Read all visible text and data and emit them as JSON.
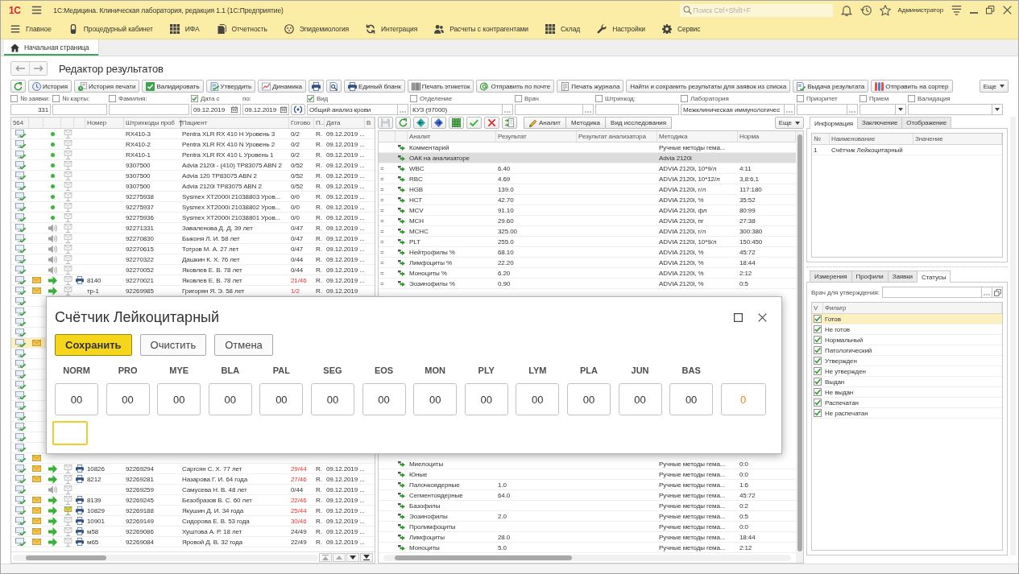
{
  "window": {
    "logo": "1С",
    "title": "1С:Медицина. Клиническая лаборатория, редакция 1.1 (1С:Предприятие)",
    "search": {
      "placeholder": "Поиск Ctrl+Shift+F"
    },
    "user": "Администратор"
  },
  "sections": [
    {
      "label": "Главное"
    },
    {
      "label": "Процедурный кабинет"
    },
    {
      "label": "ИФА"
    },
    {
      "label": "Отчетность"
    },
    {
      "label": "Эпидемиология"
    },
    {
      "label": "Интеграция"
    },
    {
      "label": "Расчеты с контрагентами"
    },
    {
      "label": "Склад"
    },
    {
      "label": "Настройки"
    },
    {
      "label": "Сервис"
    }
  ],
  "page_tabs": [
    {
      "label": "Начальная страница",
      "selected": true
    }
  ],
  "form": {
    "title": "Редактор результатов"
  },
  "toolbar": {
    "buttons": [
      {
        "label": "История"
      },
      {
        "label": "История печати"
      },
      {
        "label": "Валидировать"
      },
      {
        "label": "Утвердить"
      },
      {
        "label": "Динамика"
      },
      {
        "label": "Единый бланк"
      },
      {
        "label": "Печать этикеток"
      },
      {
        "label": "Отправить по почте"
      },
      {
        "label": "Печать журнала"
      },
      {
        "label": "Найти и сохранить результаты для заявок из списка"
      },
      {
        "label": "Выдача результата"
      },
      {
        "label": "Отправить на сортер"
      }
    ],
    "more": "Еще"
  },
  "filters": [
    {
      "label": "№ заявки:",
      "checked": false,
      "kind": "number",
      "value": "331"
    },
    {
      "label": "№ карты:",
      "checked": false,
      "kind": "text"
    },
    {
      "label": "Фамилия:",
      "checked": false,
      "kind": "text"
    },
    {
      "label": "Дата с",
      "checked": true,
      "kind": "date",
      "value": "09.12.2019"
    },
    {
      "label": "по:",
      "kind": "date",
      "value": "09.12.2019"
    },
    {
      "label": "Вид",
      "checked": true,
      "kind": "choice",
      "value": "Общий анализ крови"
    },
    {
      "label": "Отделение",
      "checked": false,
      "kind": "choice",
      "value": "КУЗ (97000)"
    },
    {
      "label": "Врач",
      "checked": false,
      "kind": "choice"
    },
    {
      "label": "Штрихкод:",
      "checked": false,
      "kind": "text"
    },
    {
      "label": "Лаборатория",
      "checked": false,
      "kind": "choice",
      "value": "Межклиническая иммунологичес"
    },
    {
      "label": "Приоритет",
      "checked": false,
      "kind": "choice"
    },
    {
      "label": "Прием",
      "checked": false,
      "kind": "select"
    },
    {
      "label": "Валидация",
      "checked": false,
      "kind": "select"
    }
  ],
  "samples": {
    "count": "564",
    "columns": [
      {
        "label": "Номер",
        "sorted": false
      },
      {
        "label": "Штрихкоды проб",
        "sorted": true
      },
      {
        "label": "Пациент",
        "sorted": false
      },
      {
        "label": "Готово",
        "sorted": false
      },
      {
        "label": "П..",
        "sorted": false
      },
      {
        "label": "Дата",
        "sorted": false
      },
      {
        "label": "В",
        "sorted": false
      }
    ],
    "rows_top": [
      {
        "selected": false,
        "sent": false,
        "kind": "control",
        "tray_active": false,
        "printed": false,
        "barcode": "RX410-3",
        "patient": "Pentra XLR RX 410 H Уровень 3",
        "ready": "0/2",
        "ready_alert": false,
        "p": "R.",
        "date": "09.12.2019 ..."
      },
      {
        "selected": false,
        "sent": false,
        "kind": "control",
        "tray_active": false,
        "printed": false,
        "barcode": "RX410-2",
        "patient": "Pentra XLR RX 410 N Уровень 2",
        "ready": "0/2",
        "ready_alert": false,
        "p": "R.",
        "date": "09.12.2019 ..."
      },
      {
        "selected": false,
        "sent": false,
        "kind": "control",
        "tray_active": false,
        "printed": false,
        "barcode": "RX410-1",
        "patient": "Pentra XLR RX 410 L Уровень 1",
        "ready": "0/2",
        "ready_alert": false,
        "p": "R.",
        "date": "09.12.2019 ..."
      },
      {
        "selected": false,
        "sent": false,
        "kind": "control",
        "tray_active": false,
        "printed": false,
        "barcode": "9307500",
        "patient": "Advia 2120i - (410) TP83075 ABN 2",
        "ready": "0/52",
        "ready_alert": false,
        "p": "R.",
        "date": "09.12.2019 ..."
      },
      {
        "selected": false,
        "sent": false,
        "kind": "control",
        "tray_active": false,
        "printed": false,
        "barcode": "9307500",
        "patient": "Advia 120 TP83075 ABN 2",
        "ready": "0/52",
        "ready_alert": false,
        "p": "R.",
        "date": "09.12.2019 ..."
      },
      {
        "selected": false,
        "sent": false,
        "kind": "control",
        "tray_active": false,
        "printed": false,
        "barcode": "9307500",
        "patient": "Advia 2120i TP83075 ABN 2",
        "ready": "0/52",
        "ready_alert": false,
        "p": "R.",
        "date": "09.12.2019 ..."
      },
      {
        "selected": false,
        "sent": false,
        "kind": "control",
        "tray_active": false,
        "printed": false,
        "barcode": "92275938",
        "patient": "Sysmex XT2000i 21038803 Уров...",
        "ready": "0/0",
        "ready_alert": false,
        "p": "R.",
        "date": "09.12.2019 ..."
      },
      {
        "selected": false,
        "sent": false,
        "kind": "control",
        "tray_active": false,
        "printed": false,
        "barcode": "92275937",
        "patient": "Sysmex XT2000i 21038802 Уров...",
        "ready": "0/0",
        "ready_alert": false,
        "p": "R.",
        "date": "09.12.2019 ..."
      },
      {
        "selected": false,
        "sent": false,
        "kind": "control",
        "tray_active": false,
        "printed": false,
        "barcode": "92275936",
        "patient": "Sysmex XT2000i 21038801 Уров...",
        "ready": "0/0",
        "ready_alert": false,
        "p": "R.",
        "date": "09.12.2019 ..."
      },
      {
        "selected": false,
        "sent": false,
        "kind": "waiting",
        "tray_active": false,
        "printed": false,
        "barcode": "92271331",
        "patient": "Заваленова Д. Д. 39 лет",
        "ready": "0/47",
        "ready_alert": false,
        "p": "R.",
        "date": "09.12.2019 ..."
      },
      {
        "selected": false,
        "sent": false,
        "kind": "waiting",
        "tray_active": false,
        "printed": false,
        "barcode": "92270830",
        "patient": "Быконя Л. И. 58 лет",
        "ready": "0/47",
        "ready_alert": false,
        "p": "R.",
        "date": "09.12.2019 ..."
      },
      {
        "selected": false,
        "sent": false,
        "kind": "waiting",
        "tray_active": false,
        "printed": false,
        "barcode": "92270615",
        "patient": "Тотров М. А. 27 лет",
        "ready": "0/47",
        "ready_alert": false,
        "p": "R.",
        "date": "09.12.2019 ..."
      },
      {
        "selected": false,
        "sent": false,
        "kind": "waiting",
        "tray_active": false,
        "printed": false,
        "barcode": "92270322",
        "patient": "Дашкин К. Х. 76 лет",
        "ready": "0/44",
        "ready_alert": false,
        "p": "R.",
        "date": "09.12.2019 ..."
      },
      {
        "selected": false,
        "sent": false,
        "kind": "waiting",
        "tray_active": false,
        "printed": false,
        "barcode": "92270052",
        "patient": "Яковлев Е. В. 78 лет",
        "ready": "0/44",
        "ready_alert": false,
        "p": "R.",
        "date": "09.12.2019 ..."
      },
      {
        "selected": false,
        "sent": true,
        "kind": "sent",
        "tray_active": false,
        "printed": true,
        "number": "8140",
        "barcode": "92270021",
        "patient": "Яковлев Е. В. 78 лет",
        "ready": "21/46",
        "ready_alert": true,
        "p": "R.",
        "date": "09.12.2019 ..."
      },
      {
        "selected": false,
        "sent": true,
        "kind": "sent",
        "tray_active": false,
        "printed": false,
        "number": "тр-1",
        "barcode": "92269985",
        "patient": "Григорян Я. Э. 58 лет",
        "ready": "1/2",
        "ready_alert": true,
        "p": "R.",
        "date": "09.12.2019"
      }
    ],
    "rows_covered": [
      {
        "selected": false,
        "sent": false
      },
      {
        "selected": false,
        "sent": false
      },
      {
        "selected": false,
        "sent": false
      },
      {
        "selected": false,
        "sent": false
      },
      {
        "selected": true,
        "sent": true
      },
      {
        "selected": false,
        "sent": false
      },
      {
        "selected": false,
        "sent": false
      },
      {
        "selected": false,
        "sent": false
      },
      {
        "selected": false,
        "sent": false
      },
      {
        "selected": false,
        "sent": false
      },
      {
        "selected": false,
        "sent": false
      },
      {
        "selected": false,
        "sent": false
      },
      {
        "selected": false,
        "sent": false
      },
      {
        "selected": false,
        "sent": false
      },
      {
        "selected": false,
        "sent": false
      },
      {
        "selected": false,
        "sent": true
      }
    ],
    "rows_bottom": [
      {
        "selected": false,
        "sent": true,
        "kind": "sent",
        "tray_active": false,
        "printed": true,
        "number": "10826",
        "barcode": "92269294",
        "patient": "Саргсян С. Х. 77 лет",
        "ready": "29/44",
        "ready_alert": true,
        "p": "R.",
        "date": "09.12.2019 ..."
      },
      {
        "selected": false,
        "sent": true,
        "kind": "sent",
        "tray_active": false,
        "printed": true,
        "number": "8212",
        "barcode": "92269281",
        "patient": "Назарова Г. И. 64 года",
        "ready": "27/46",
        "ready_alert": true,
        "p": "R.",
        "date": "09.12.2019 ..."
      },
      {
        "selected": false,
        "sent": false,
        "kind": "waiting",
        "tray_active": false,
        "printed": false,
        "barcode": "92269259",
        "patient": "Самусева Н. В. 48 лет",
        "ready": "0/44",
        "ready_alert": false,
        "p": "R.",
        "date": "09.12.2019 ..."
      },
      {
        "selected": false,
        "sent": true,
        "kind": "sent",
        "tray_active": false,
        "printed": true,
        "number": "8139",
        "barcode": "92269245",
        "patient": "Безобразов В. С. 60 лет",
        "ready": "22/46",
        "ready_alert": true,
        "p": "R.",
        "date": "09.12.2019 ..."
      },
      {
        "selected": false,
        "sent": true,
        "kind": "sent",
        "tray_active": true,
        "printed": true,
        "number": "10829",
        "barcode": "92269188",
        "patient": "Якушин Д. И. 34 года",
        "ready": "25/44",
        "ready_alert": true,
        "p": "R.",
        "date": "09.12.2019 ..."
      },
      {
        "selected": false,
        "sent": true,
        "kind": "sent",
        "tray_active": false,
        "printed": true,
        "number": "10901",
        "barcode": "92269149",
        "patient": "Сидорова Е. В. 53 года",
        "ready": "30/46",
        "ready_alert": true,
        "p": "R.",
        "date": "09.12.2019 ..."
      },
      {
        "selected": false,
        "sent": true,
        "kind": "sent",
        "tray_active": false,
        "printed": true,
        "number": "м58",
        "barcode": "92269086",
        "patient": "Хуштова А. Р. 18 лет",
        "ready": "24/49",
        "ready_alert": false,
        "p": "R.",
        "date": "09.12.2019 ..."
      },
      {
        "selected": false,
        "sent": true,
        "kind": "sent",
        "tray_active": false,
        "printed": true,
        "number": "м65",
        "barcode": "92269084",
        "patient": "Яровой Д. В. 32 года",
        "ready": "22/49",
        "ready_alert": false,
        "p": "R.",
        "date": "09.12.2019 ..."
      }
    ]
  },
  "analytes": {
    "toolbar": {
      "buttons": [
        "Аналит",
        "Методика",
        "Вид исследования"
      ],
      "more": "Еще"
    },
    "columns": [
      "Аналит",
      "Результат",
      "Результат анализатора",
      "Методика",
      "Норма"
    ],
    "rows_top": [
      {
        "name": "Комментарий",
        "method": "Ручные методы гема...",
        "selected": false
      },
      {
        "name": "ОАК на анализаторе",
        "method": "Advia 2120i",
        "selected": true
      },
      {
        "flag": "=",
        "name": "WBC",
        "result": "6.40",
        "method": "ADVIA 2120i, 10*9/л",
        "norm": "4:11",
        "selected": false
      },
      {
        "flag": "=",
        "name": "RBC",
        "result": "4.69",
        "method": "ADVIA 2120i, 10*12/л",
        "norm": "3,8:6,1",
        "selected": false
      },
      {
        "flag": "=",
        "name": "HGB",
        "result": "139.0",
        "method": "ADVIA 2120i, г/л",
        "norm": "117:180",
        "selected": false
      },
      {
        "flag": "=",
        "name": "HCT",
        "result": "42.70",
        "method": "ADVIA 2120i, %",
        "norm": "35:52",
        "selected": false
      },
      {
        "flag": "=",
        "name": "MCV",
        "result": "91.10",
        "method": "ADVIA 2120i, фл",
        "norm": "80:99",
        "selected": false
      },
      {
        "flag": "=",
        "name": "MCH",
        "result": "29.60",
        "method": "ADVIA 2120i, пг",
        "norm": "27:38",
        "selected": false
      },
      {
        "flag": "=",
        "name": "MCHC",
        "result": "325.00",
        "method": "ADVIA 2120i, г/л",
        "norm": "300:380",
        "selected": false
      },
      {
        "flag": "=",
        "name": "PLT",
        "result": "255.0",
        "method": "ADVIA 2120i, 10*9/л",
        "norm": "150:450",
        "selected": false
      },
      {
        "flag": "=",
        "name": "Нейтрофилы %",
        "result": "68.10",
        "method": "ADVIA 2120i, %",
        "norm": "45:72",
        "selected": false
      },
      {
        "flag": "=",
        "name": "Лимфоциты %",
        "result": "22.20",
        "method": "ADVIA 2120i, %",
        "norm": "18:44",
        "selected": false
      },
      {
        "flag": "=",
        "name": "Моноциты %",
        "result": "6.20",
        "method": "ADVIA 2120i, %",
        "norm": "2:12",
        "selected": false
      },
      {
        "flag": "=",
        "name": "Эозинофилы %",
        "result": "0.90",
        "method": "ADVIA 2120i, %",
        "norm": "0:5",
        "selected": false
      }
    ],
    "rows_bottom": [
      {
        "name": "Миелоциты",
        "method": "Ручные методы гема...",
        "norm": "0:0",
        "selected": false
      },
      {
        "name": "Юные",
        "method": "Ручные методы гема...",
        "norm": "0:0",
        "selected": false
      },
      {
        "name": "Палочкоядерные",
        "result": "1.0",
        "method": "Ручные методы гема...",
        "norm": "1:6",
        "selected": false
      },
      {
        "name": "Сегментоядерные",
        "result": "64.0",
        "method": "Ручные методы гема...",
        "norm": "45:72",
        "selected": false
      },
      {
        "name": "Базофилы",
        "method": "Ручные методы гема...",
        "norm": "0:2",
        "selected": false
      },
      {
        "name": "Эозинофилы",
        "result": "2.0",
        "method": "Ручные методы гема...",
        "norm": "0:5",
        "selected": false
      },
      {
        "name": "Пролимфоциты",
        "method": "Ручные методы гема...",
        "norm": "0:0",
        "selected": false
      },
      {
        "name": "Лимфоциты",
        "result": "28.0",
        "method": "Ручные методы гема...",
        "norm": "18:44",
        "selected": false
      },
      {
        "name": "Моноциты",
        "result": "5.0",
        "method": "Ручные методы гема...",
        "norm": "2:12",
        "selected": false
      }
    ]
  },
  "details": {
    "tabs": [
      {
        "label": "Информация",
        "selected": true
      },
      {
        "label": "Заключение",
        "selected": false
      },
      {
        "label": "Отображение",
        "selected": false
      }
    ],
    "columns": [
      "№",
      "Наименование",
      "Значение"
    ],
    "rows": [
      {
        "n": "1",
        "name": "Счётчик Лейкоцитарный"
      }
    ]
  },
  "filters_panel": {
    "tabs": [
      {
        "label": "Измерения",
        "selected": false
      },
      {
        "label": "Профили",
        "selected": false
      },
      {
        "label": "Заявки",
        "selected": false
      },
      {
        "label": "Статусы",
        "selected": true
      }
    ],
    "doctor_label": "Врач для утверждения:",
    "columns": [
      "V",
      "Фильтр"
    ],
    "statuses": [
      {
        "label": "Готов",
        "checked": true,
        "selected": true
      },
      {
        "label": "Не готов",
        "checked": true,
        "selected": false
      },
      {
        "label": "Нормальный",
        "checked": true,
        "selected": false
      },
      {
        "label": "Патологический",
        "checked": true,
        "selected": false
      },
      {
        "label": "Утвержден",
        "checked": true,
        "selected": false
      },
      {
        "label": "Не утвержден",
        "checked": true,
        "selected": false
      },
      {
        "label": "Выдан",
        "checked": true,
        "selected": false
      },
      {
        "label": "Не выдан",
        "checked": true,
        "selected": false
      },
      {
        "label": "Распечатан",
        "checked": true,
        "selected": false
      },
      {
        "label": "Не распечатан",
        "checked": true,
        "selected": false
      }
    ]
  },
  "dialog": {
    "title": "Счётчик Лейкоцитарный",
    "buttons": [
      {
        "label": "Сохранить",
        "kind": "primary"
      },
      {
        "label": "Очистить",
        "kind": "default"
      },
      {
        "label": "Отмена",
        "kind": "default"
      }
    ],
    "counters": [
      {
        "label": "NORM",
        "value": "00"
      },
      {
        "label": "PRO",
        "value": "00"
      },
      {
        "label": "MYE",
        "value": "00"
      },
      {
        "label": "BLA",
        "value": "00"
      },
      {
        "label": "PAL",
        "value": "00"
      },
      {
        "label": "SEG",
        "value": "00"
      },
      {
        "label": "EOS",
        "value": "00"
      },
      {
        "label": "MON",
        "value": "00"
      },
      {
        "label": "PLY",
        "value": "00"
      },
      {
        "label": "LYM",
        "value": "00"
      },
      {
        "label": "PLA",
        "value": "00"
      },
      {
        "label": "JUN",
        "value": "00"
      },
      {
        "label": "BAS",
        "value": "00"
      }
    ],
    "total": "0",
    "input": {
      "focused": true
    }
  }
}
